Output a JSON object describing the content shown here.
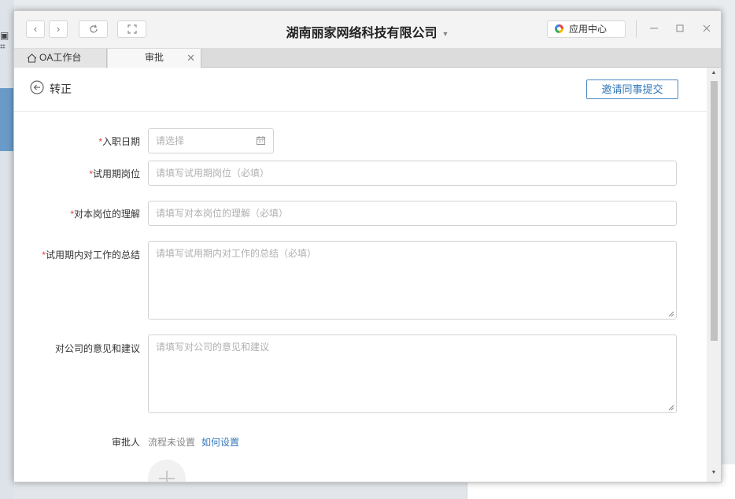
{
  "window": {
    "title": "湖南丽家网络科技有限公司",
    "app_center_label": "应用中心"
  },
  "tabs": [
    {
      "label": "OA工作台",
      "icon": "home-icon"
    },
    {
      "label": "审批",
      "icon": "close-icon"
    }
  ],
  "page": {
    "title": "转正",
    "invite_button": "邀请同事提交"
  },
  "form": {
    "required_mark": "*",
    "entry_date": {
      "label": "入职日期",
      "placeholder": "请选择"
    },
    "probation_position": {
      "label": "试用期岗位",
      "placeholder": "请填写试用期岗位（必填）"
    },
    "position_understanding": {
      "label": "对本岗位的理解",
      "placeholder": "请填写对本岗位的理解（必填）"
    },
    "probation_summary": {
      "label": "试用期内对工作的总结",
      "placeholder": "请填写试用期内对工作的总结（必填）"
    },
    "suggestions": {
      "label": "对公司的意见和建议",
      "placeholder": "请填写对公司的意见和建议"
    }
  },
  "approver": {
    "label": "审批人",
    "status": "流程未设置",
    "link": "如何设置"
  },
  "colors": {
    "accent": "#3478b8",
    "required": "#e03b3b"
  }
}
